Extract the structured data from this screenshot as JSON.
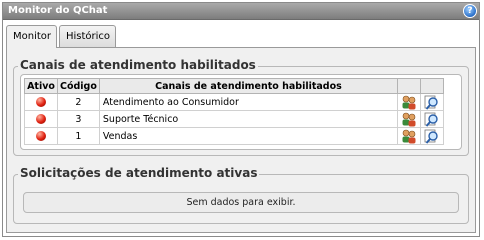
{
  "window": {
    "title": "Monitor do QChat",
    "help_icon": "help-icon"
  },
  "tabs": [
    {
      "label": "Monitor",
      "active": true
    },
    {
      "label": "Histórico",
      "active": false
    }
  ],
  "channels_group": {
    "title": "Canais de atendimento habilitados",
    "columns": [
      "Ativo",
      "Código",
      "Canais de atendimento habilitados"
    ],
    "rows": [
      {
        "active": true,
        "code": "2",
        "name": "Atendimento ao Consumidor"
      },
      {
        "active": true,
        "code": "3",
        "name": "Suporte Técnico"
      },
      {
        "active": true,
        "code": "1",
        "name": "Vendas"
      }
    ],
    "row_actions": [
      "users-icon",
      "magnifier-icon"
    ]
  },
  "requests_group": {
    "title": "Solicitações de atendimento ativas",
    "empty_message": "Sem dados para exibir."
  },
  "colors": {
    "titlebar": "#8c8c8c",
    "panel_bg": "#f0f0f0",
    "led_red": "#e02010"
  }
}
